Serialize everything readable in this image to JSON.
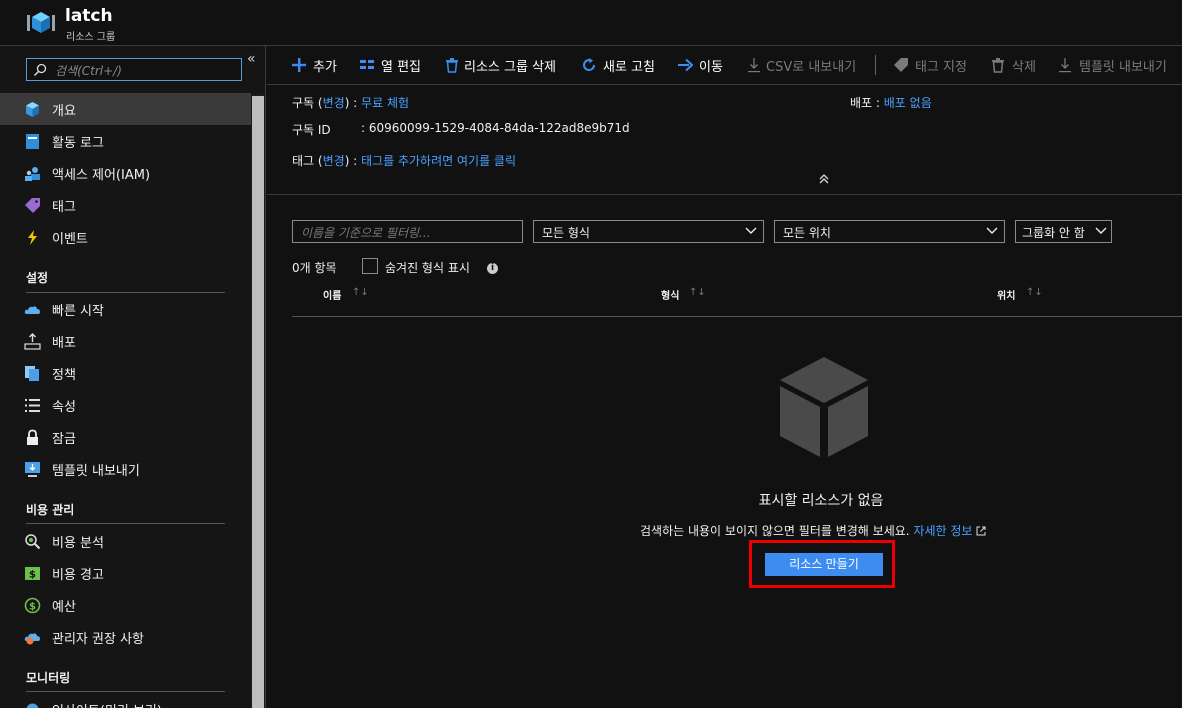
{
  "header": {
    "name": "latch",
    "subtitle": "리소스 그룹"
  },
  "search": {
    "placeholder": "검색(Ctrl+/)"
  },
  "collapse_label": "«",
  "sidebar": {
    "top_items": [
      {
        "label": "개요",
        "icon": "resource-group-icon"
      },
      {
        "label": "활동 로그",
        "icon": "log-icon"
      },
      {
        "label": "액세스 제어(IAM)",
        "icon": "users-icon"
      },
      {
        "label": "태그",
        "icon": "tag-icon"
      },
      {
        "label": "이벤트",
        "icon": "lightning-icon"
      }
    ],
    "settings": {
      "title": "설정",
      "items": [
        {
          "label": "빠른 시작",
          "icon": "cloud-icon"
        },
        {
          "label": "배포",
          "icon": "deploy-icon"
        },
        {
          "label": "정책",
          "icon": "policy-icon"
        },
        {
          "label": "속성",
          "icon": "properties-icon"
        },
        {
          "label": "잠금",
          "icon": "lock-icon"
        },
        {
          "label": "템플릿 내보내기",
          "icon": "export-template-icon"
        }
      ]
    },
    "cost": {
      "title": "비용 관리",
      "items": [
        {
          "label": "비용 분석",
          "icon": "cost-analysis-icon"
        },
        {
          "label": "비용 경고",
          "icon": "cost-alert-icon"
        },
        {
          "label": "예산",
          "icon": "budget-icon"
        },
        {
          "label": "관리자 권장 사항",
          "icon": "advisor-icon"
        }
      ]
    },
    "monitoring": {
      "title": "모니터링",
      "items": [
        {
          "label": "인사이트(미리 보기)",
          "icon": "insights-icon"
        }
      ]
    }
  },
  "toolbar": {
    "add": "추가",
    "edit_columns": "열 편집",
    "delete_group": "리소스 그룹 삭제",
    "refresh": "새로 고침",
    "move": "이동",
    "export_csv": "CSV로 내보내기",
    "assign_tags": "태그 지정",
    "delete": "삭제",
    "export_template": "템플릿 내보내기"
  },
  "essentials": {
    "subscription_label": "구독",
    "change_label": "변경",
    "subscription_value": "무료 체험",
    "subscription_id_label": "구독 ID",
    "subscription_id_value": "60960099-1529-4084-84da-122ad8e9b71d",
    "tags_label": "태그",
    "tags_value": "태그를 추가하려면 여기를 클릭",
    "deployment_label": "배포",
    "deployment_value": "배포 없음"
  },
  "filters": {
    "name_placeholder": "이름을 기준으로 필터링...",
    "type_value": "모든 형식",
    "location_value": "모든 위치",
    "grouping_value": "그룹화 안 함"
  },
  "list": {
    "count": "0개 항목",
    "show_hidden_types": "숨겨진 형식 표시",
    "columns": [
      "이름",
      "형식",
      "위치"
    ]
  },
  "empty_state": {
    "title": "표시할 리소스가 없음",
    "description": "검색하는 내용이 보이지 않으면 필터를 변경해 보세요.",
    "learn_more": "자세한 정보",
    "create_button": "리소스 만들기"
  },
  "colors": {
    "accent": "#3d8cf0",
    "link": "#4aa0ff",
    "highlight": "#ee0000"
  }
}
